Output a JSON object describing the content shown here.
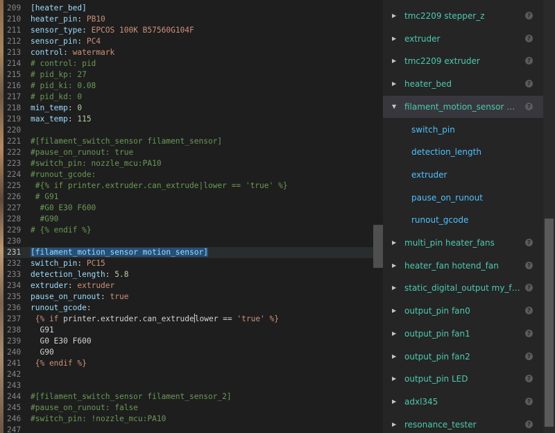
{
  "editor": {
    "lines": [
      {
        "no": "209",
        "tokens": [
          {
            "t": "sec",
            "v": "[heater_bed]"
          }
        ]
      },
      {
        "no": "210",
        "tokens": [
          {
            "t": "key",
            "v": "heater_pin"
          },
          {
            "t": "plain",
            "v": ": "
          },
          {
            "t": "val",
            "v": "PB10"
          }
        ]
      },
      {
        "no": "211",
        "tokens": [
          {
            "t": "key",
            "v": "sensor_type"
          },
          {
            "t": "plain",
            "v": ": "
          },
          {
            "t": "val",
            "v": "EPCOS 100K B57560G104F"
          }
        ]
      },
      {
        "no": "212",
        "tokens": [
          {
            "t": "key",
            "v": "sensor_pin"
          },
          {
            "t": "plain",
            "v": ": "
          },
          {
            "t": "val",
            "v": "PC4"
          }
        ]
      },
      {
        "no": "213",
        "tokens": [
          {
            "t": "key",
            "v": "control"
          },
          {
            "t": "plain",
            "v": ": "
          },
          {
            "t": "val",
            "v": "watermark"
          }
        ]
      },
      {
        "no": "214",
        "tokens": [
          {
            "t": "com",
            "v": "# control: pid"
          }
        ]
      },
      {
        "no": "215",
        "tokens": [
          {
            "t": "com",
            "v": "# pid_kp: 27"
          }
        ]
      },
      {
        "no": "216",
        "tokens": [
          {
            "t": "com",
            "v": "# pid_ki: 0.08"
          }
        ]
      },
      {
        "no": "217",
        "tokens": [
          {
            "t": "com",
            "v": "# pid_kd: 0"
          }
        ]
      },
      {
        "no": "218",
        "tokens": [
          {
            "t": "key",
            "v": "min_temp"
          },
          {
            "t": "plain",
            "v": ": "
          },
          {
            "t": "num",
            "v": "0"
          }
        ]
      },
      {
        "no": "219",
        "tokens": [
          {
            "t": "key",
            "v": "max_temp"
          },
          {
            "t": "plain",
            "v": ": "
          },
          {
            "t": "num",
            "v": "115"
          }
        ]
      },
      {
        "no": "220",
        "tokens": []
      },
      {
        "no": "221",
        "tokens": [
          {
            "t": "com",
            "v": "#[filament_switch_sensor filament_sensor]"
          }
        ]
      },
      {
        "no": "222",
        "tokens": [
          {
            "t": "com",
            "v": "#pause_on_runout: true"
          }
        ]
      },
      {
        "no": "223",
        "tokens": [
          {
            "t": "com",
            "v": "#switch_pin: nozzle_mcu:PA10"
          }
        ]
      },
      {
        "no": "224",
        "tokens": [
          {
            "t": "com",
            "v": "#runout_gcode:"
          }
        ]
      },
      {
        "no": "225",
        "tokens": [
          {
            "t": "com",
            "v": " #{% if printer.extruder.can_extrude|lower == 'true' %}"
          }
        ]
      },
      {
        "no": "226",
        "tokens": [
          {
            "t": "com",
            "v": " # G91"
          }
        ]
      },
      {
        "no": "227",
        "tokens": [
          {
            "t": "com",
            "v": "  #G0 E30 F600"
          }
        ]
      },
      {
        "no": "228",
        "tokens": [
          {
            "t": "com",
            "v": "  #G90"
          }
        ]
      },
      {
        "no": "229",
        "tokens": [
          {
            "t": "com",
            "v": "# {% endif %}"
          }
        ]
      },
      {
        "no": "230",
        "tokens": []
      },
      {
        "no": "231",
        "active": true,
        "tokens": [
          {
            "t": "sec",
            "v": "[filament_motion_sensor motion_sensor]",
            "sel": true
          }
        ]
      },
      {
        "no": "232",
        "tokens": [
          {
            "t": "key",
            "v": "switch_pin"
          },
          {
            "t": "plain",
            "v": ": "
          },
          {
            "t": "val",
            "v": "PC15"
          }
        ]
      },
      {
        "no": "233",
        "tokens": [
          {
            "t": "key",
            "v": "detection_length"
          },
          {
            "t": "plain",
            "v": ": "
          },
          {
            "t": "num",
            "v": "5.8"
          }
        ]
      },
      {
        "no": "234",
        "tokens": [
          {
            "t": "key",
            "v": "extruder"
          },
          {
            "t": "plain",
            "v": ": "
          },
          {
            "t": "val",
            "v": "extruder"
          }
        ]
      },
      {
        "no": "235",
        "tokens": [
          {
            "t": "key",
            "v": "pause_on_runout"
          },
          {
            "t": "plain",
            "v": ": "
          },
          {
            "t": "val",
            "v": "true"
          }
        ]
      },
      {
        "no": "236",
        "tokens": [
          {
            "t": "key",
            "v": "runout_gcode"
          },
          {
            "t": "plain",
            "v": ":"
          }
        ]
      },
      {
        "no": "237",
        "tokens": [
          {
            "t": "val",
            "v": " {% if "
          },
          {
            "t": "plain",
            "v": "printer.extruder.can_extrude"
          },
          {
            "t": "cursor",
            "v": ""
          },
          {
            "t": "plain",
            "v": "lower == "
          },
          {
            "t": "val",
            "v": "'true' %}"
          }
        ]
      },
      {
        "no": "238",
        "tokens": [
          {
            "t": "plain",
            "v": "  G91"
          }
        ]
      },
      {
        "no": "239",
        "tokens": [
          {
            "t": "plain",
            "v": "  G0 E30 F600"
          }
        ]
      },
      {
        "no": "240",
        "tokens": [
          {
            "t": "plain",
            "v": "  G90"
          }
        ]
      },
      {
        "no": "241",
        "tokens": [
          {
            "t": "val",
            "v": " {% endif %}"
          }
        ]
      },
      {
        "no": "242",
        "tokens": []
      },
      {
        "no": "243",
        "tokens": []
      },
      {
        "no": "244",
        "tokens": [
          {
            "t": "com",
            "v": "#[filament_switch_sensor filament_sensor_2]"
          }
        ]
      },
      {
        "no": "245",
        "tokens": [
          {
            "t": "com",
            "v": "#pause_on_runout: false"
          }
        ]
      },
      {
        "no": "246",
        "tokens": [
          {
            "t": "com",
            "v": "#switch_pin: !nozzle_mcu:PA10"
          }
        ]
      },
      {
        "no": "247",
        "tokens": []
      }
    ]
  },
  "outline": {
    "help_glyph": "?",
    "items": [
      {
        "label": "tmc2209 stepper_z",
        "expanded": false,
        "child": false
      },
      {
        "label": "extruder",
        "expanded": false,
        "child": false
      },
      {
        "label": "tmc2209 extruder",
        "expanded": false,
        "child": false
      },
      {
        "label": "heater_bed",
        "expanded": false,
        "child": false
      },
      {
        "label": "filament_motion_sensor motion_sensor",
        "expanded": true,
        "child": false,
        "selected": true
      },
      {
        "label": "switch_pin",
        "child": true
      },
      {
        "label": "detection_length",
        "child": true
      },
      {
        "label": "extruder",
        "child": true
      },
      {
        "label": "pause_on_runout",
        "child": true
      },
      {
        "label": "runout_gcode",
        "child": true
      },
      {
        "label": "multi_pin heater_fans",
        "expanded": false,
        "child": false
      },
      {
        "label": "heater_fan hotend_fan",
        "expanded": false,
        "child": false
      },
      {
        "label": "static_digital_output my_fan_output_pins",
        "expanded": false,
        "child": false
      },
      {
        "label": "output_pin fan0",
        "expanded": false,
        "child": false
      },
      {
        "label": "output_pin fan1",
        "expanded": false,
        "child": false
      },
      {
        "label": "output_pin fan2",
        "expanded": false,
        "child": false
      },
      {
        "label": "output_pin LED",
        "expanded": false,
        "child": false
      },
      {
        "label": "adxl345",
        "expanded": false,
        "child": false
      },
      {
        "label": "resonance_tester",
        "expanded": false,
        "child": false
      }
    ]
  }
}
